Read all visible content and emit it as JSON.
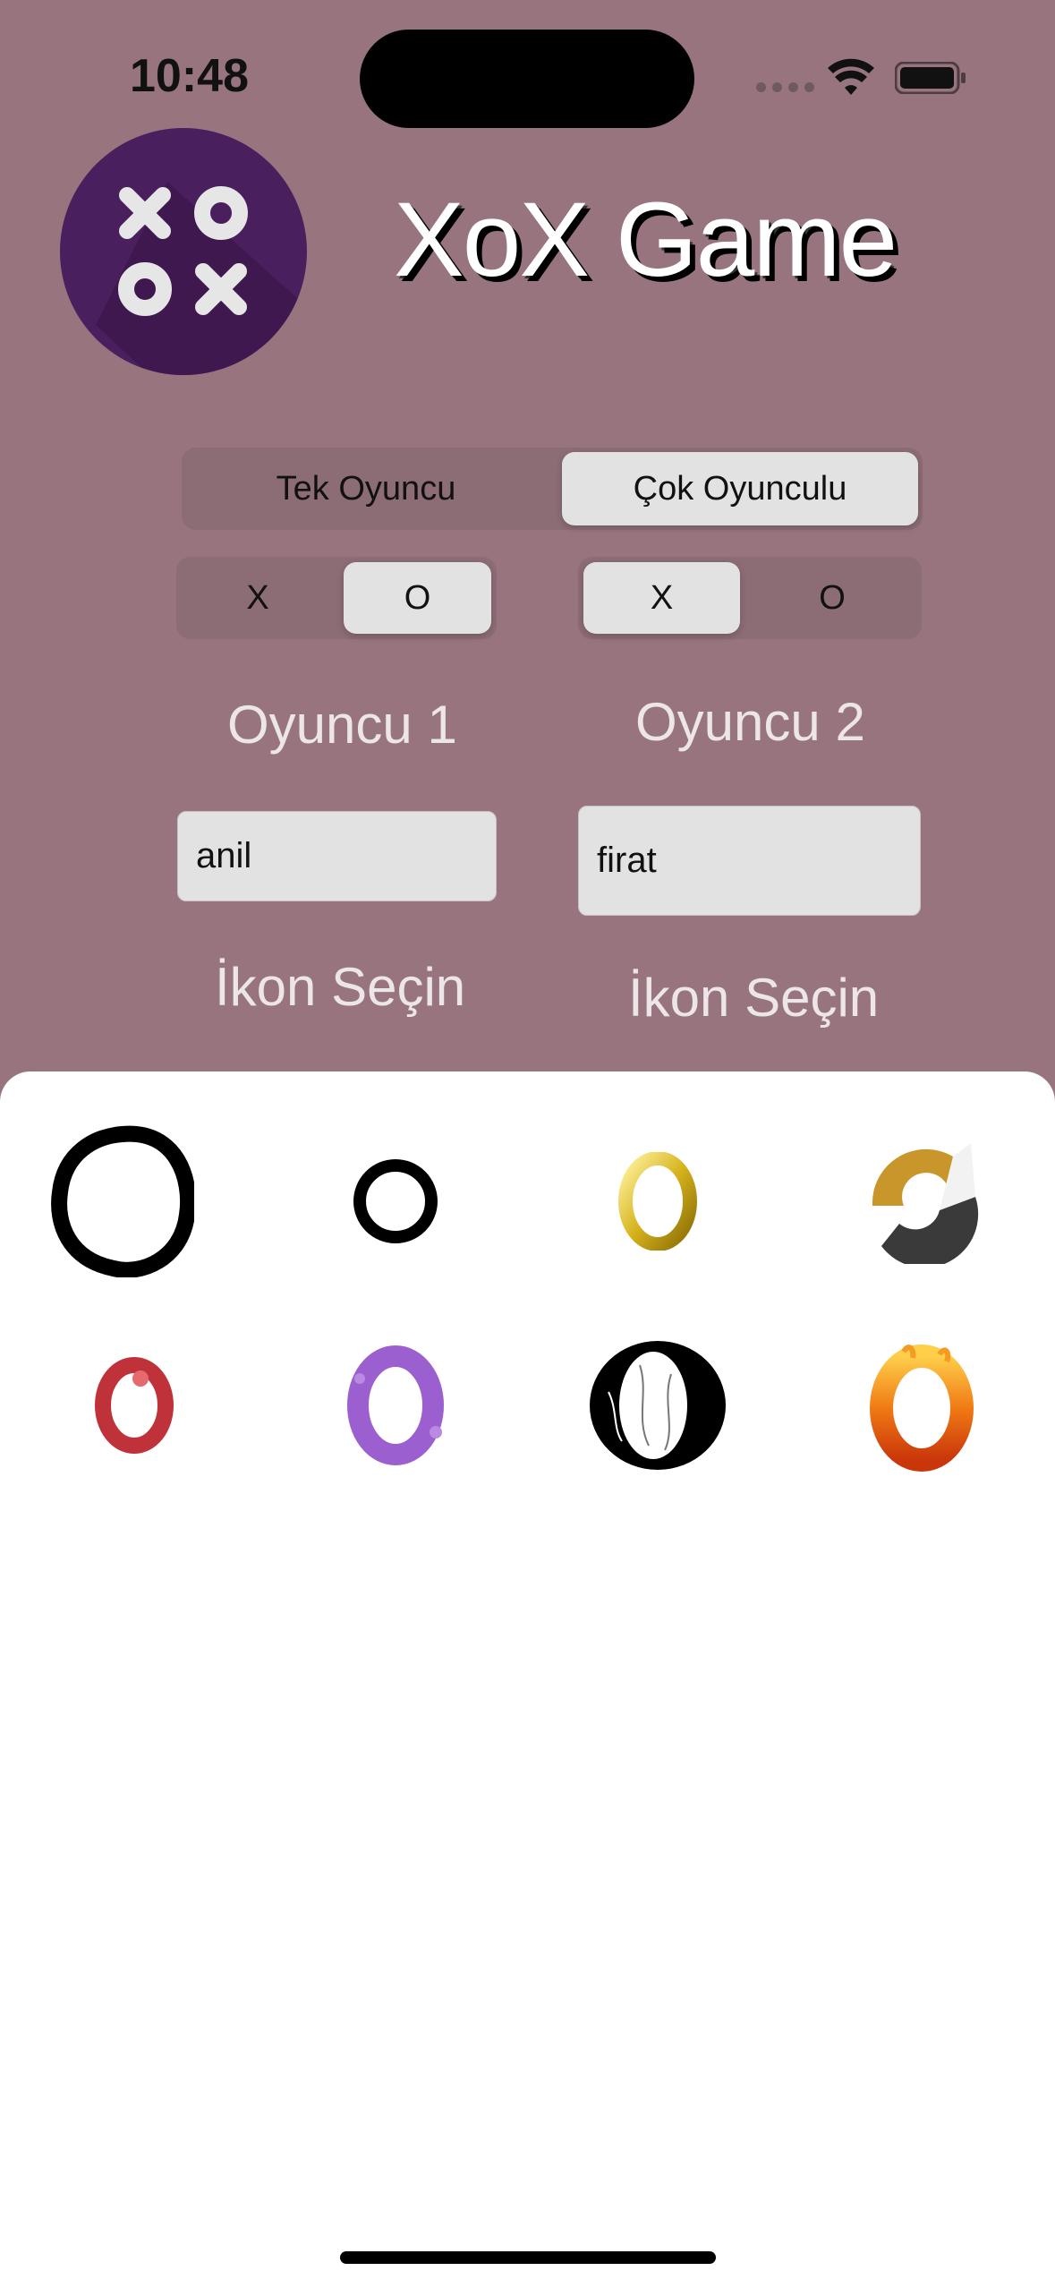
{
  "status_bar": {
    "time": "10:48"
  },
  "app": {
    "title": "XoX Game"
  },
  "mode_segment": {
    "options": [
      "Tek Oyuncu",
      "Çok Oyunculu"
    ],
    "selected": "Çok Oyunculu"
  },
  "player1": {
    "symbol_options": [
      "X",
      "O"
    ],
    "selected_symbol": "O",
    "label": "Oyuncu 1",
    "name": "anil",
    "icon_label": "İkon Seçin"
  },
  "player2": {
    "symbol_options": [
      "X",
      "O"
    ],
    "selected_symbol": "X",
    "label": "Oyuncu 2",
    "name": "firat",
    "icon_label": "İkon Seçin"
  },
  "icon_picker": {
    "icons": [
      "hand-drawn-o-icon",
      "plain-o-icon",
      "gold-o-icon",
      "gold-gray-c-icon",
      "red-o-icon",
      "purple-splash-o-icon",
      "floral-o-icon",
      "fire-o-icon"
    ]
  },
  "colors": {
    "background": "#98747E",
    "sheet": "#FFFFFF",
    "logo": "#4A1F5E"
  }
}
